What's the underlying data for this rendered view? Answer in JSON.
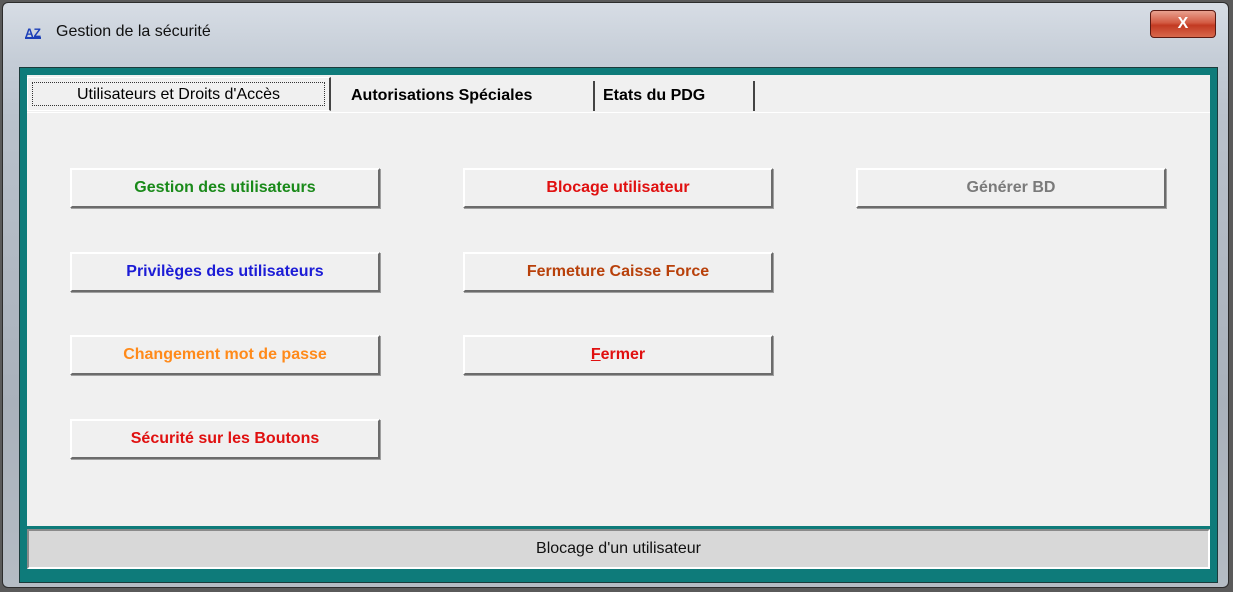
{
  "window": {
    "title": "Gestion de la sécurité",
    "app_icon_text": "AZ",
    "close_glyph": "X"
  },
  "tabs": [
    {
      "label": "Utilisateurs et Droits d'Accès",
      "active": true
    },
    {
      "label": "Autorisations Spéciales",
      "active": false
    },
    {
      "label": "Etats du PDG",
      "active": false
    }
  ],
  "buttons": {
    "gestion_utilisateurs": {
      "label": "Gestion des utilisateurs",
      "color": "#1a8a1a"
    },
    "privileges": {
      "label": "Privilèges des utilisateurs",
      "color": "#1c1cd6"
    },
    "changement_mdp": {
      "label": "Changement mot de passe",
      "color": "#ff8a1a"
    },
    "securite_boutons": {
      "label": "Sécurité sur les Boutons",
      "color": "#e01010"
    },
    "blocage": {
      "label": "Blocage utilisateur",
      "color": "#e01010"
    },
    "fermeture_caisse": {
      "label": "Fermeture Caisse Force",
      "color": "#b8400a"
    },
    "fermer": {
      "label_first": "F",
      "label_rest": "ermer",
      "color": "#e01010"
    },
    "generer_bd": {
      "label": "Générer BD",
      "color": "#7a7a7a",
      "disabled": true
    }
  },
  "status_bar": {
    "text": "Blocage d'un utilisateur"
  }
}
